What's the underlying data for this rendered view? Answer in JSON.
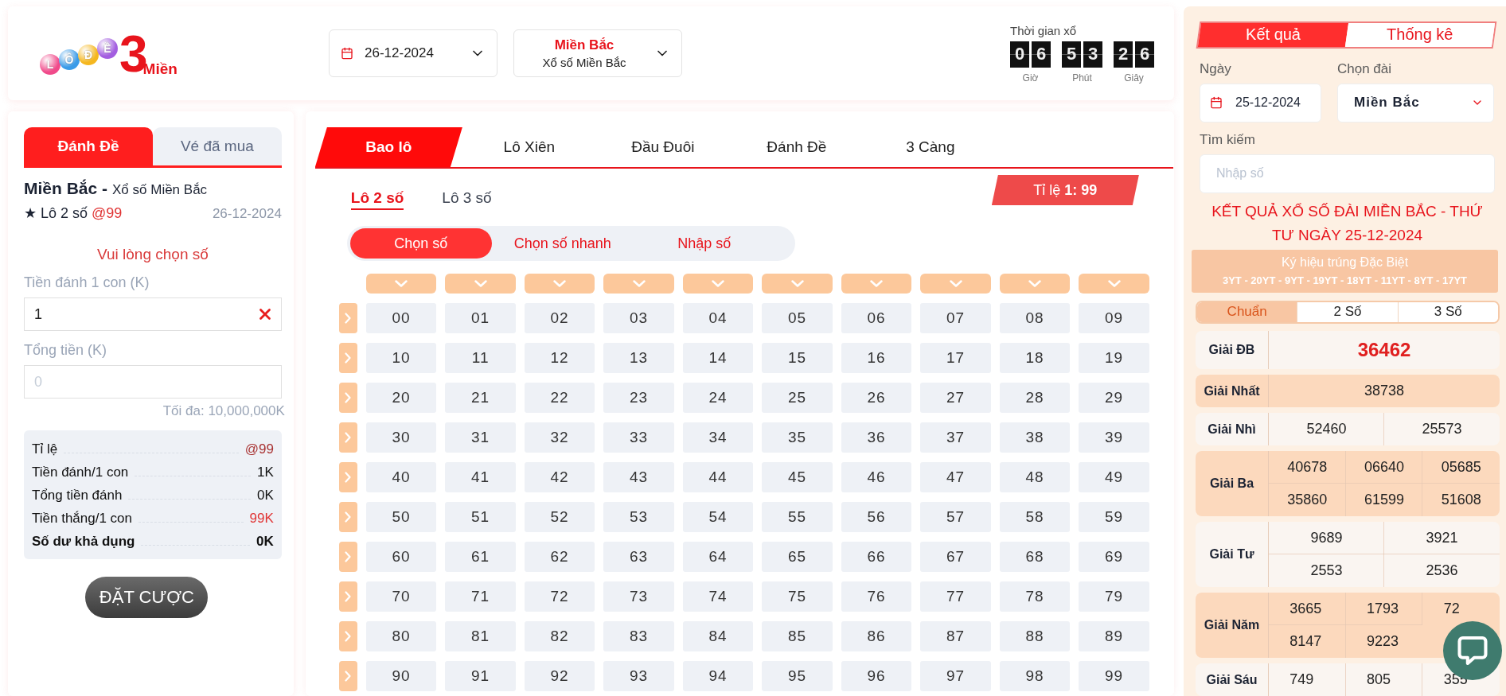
{
  "header": {
    "logo": {
      "letters": [
        "L",
        "Ô",
        "Đ",
        "Ề"
      ],
      "number": "3",
      "word": "Miền"
    },
    "date_select": {
      "value": "26-12-2024"
    },
    "region_select": {
      "title": "Miền Bắc",
      "subtitle": "Xổ số Miền Bắc"
    },
    "countdown": {
      "label": "Thời gian xổ",
      "units": [
        {
          "digits": [
            "0",
            "6"
          ],
          "label": "Giờ"
        },
        {
          "digits": [
            "5",
            "3"
          ],
          "label": "Phút"
        },
        {
          "digits": [
            "2",
            "6"
          ],
          "label": "Giây"
        }
      ]
    }
  },
  "bet_panel": {
    "tabs": [
      {
        "label": "Đánh Đề",
        "selected": true
      },
      {
        "label": "Vé đã mua",
        "selected": false
      }
    ],
    "region": "Miền Bắc -",
    "region_sub": "Xổ số Miền Bắc",
    "bet_type": "★ Lô 2 số",
    "odds": "@99",
    "date": "26-12-2024",
    "notice": "Vui lòng chọn số",
    "amount": {
      "label": "Tiền đánh 1 con (K)",
      "value": "1"
    },
    "total": {
      "label": "Tổng tiền (K)",
      "placeholder": "0"
    },
    "max_note": "Tối đa: 10,000,000K",
    "summary": [
      {
        "label": "Tỉ lệ",
        "value": "@99",
        "kind": "odds"
      },
      {
        "label": "Tiền đánh/1 con",
        "value": "1K",
        "kind": "plain"
      },
      {
        "label": "Tổng tiền đánh",
        "value": "0K",
        "kind": "plain"
      },
      {
        "label": "Tiền thắng/1 con",
        "value": "99K",
        "kind": "win"
      },
      {
        "label": "Số dư khả dụng",
        "value": "0K",
        "kind": "strong"
      }
    ],
    "submit": "ĐẶT CƯỢC"
  },
  "game": {
    "tabs": [
      {
        "label": "Bao lô",
        "selected": true
      },
      {
        "label": "Lô Xiên",
        "selected": false
      },
      {
        "label": "Đầu Đuôi",
        "selected": false
      },
      {
        "label": "Đánh Đề",
        "selected": false
      },
      {
        "label": "3 Càng",
        "selected": false
      }
    ],
    "subtabs": [
      {
        "label": "Lô 2 số",
        "selected": true
      },
      {
        "label": "Lô 3 số",
        "selected": false
      }
    ],
    "ratio": {
      "label": "Tỉ lệ",
      "value": "1: 99"
    },
    "modes": [
      {
        "label": "Chọn số",
        "selected": true
      },
      {
        "label": "Chọn số nhanh",
        "selected": false
      },
      {
        "label": "Nhập số",
        "selected": false
      }
    ],
    "grid": [
      [
        "00",
        "01",
        "02",
        "03",
        "04",
        "05",
        "06",
        "07",
        "08",
        "09"
      ],
      [
        "10",
        "11",
        "12",
        "13",
        "14",
        "15",
        "16",
        "17",
        "18",
        "19"
      ],
      [
        "20",
        "21",
        "22",
        "23",
        "24",
        "25",
        "26",
        "27",
        "28",
        "29"
      ],
      [
        "30",
        "31",
        "32",
        "33",
        "34",
        "35",
        "36",
        "37",
        "38",
        "39"
      ],
      [
        "40",
        "41",
        "42",
        "43",
        "44",
        "45",
        "46",
        "47",
        "48",
        "49"
      ],
      [
        "50",
        "51",
        "52",
        "53",
        "54",
        "55",
        "56",
        "57",
        "58",
        "59"
      ],
      [
        "60",
        "61",
        "62",
        "63",
        "64",
        "65",
        "66",
        "67",
        "68",
        "69"
      ],
      [
        "70",
        "71",
        "72",
        "73",
        "74",
        "75",
        "76",
        "77",
        "78",
        "79"
      ],
      [
        "80",
        "81",
        "82",
        "83",
        "84",
        "85",
        "86",
        "87",
        "88",
        "89"
      ],
      [
        "90",
        "91",
        "92",
        "93",
        "94",
        "95",
        "96",
        "97",
        "98",
        "99"
      ]
    ]
  },
  "results": {
    "tabs": [
      {
        "label": "Kết quả",
        "selected": true
      },
      {
        "label": "Thống kê",
        "selected": false
      }
    ],
    "date": {
      "label": "Ngày",
      "value": "25-12-2024"
    },
    "station": {
      "label": "Chọn đài",
      "value": "Miền Bắc"
    },
    "search": {
      "label": "Tìm kiếm",
      "placeholder": "Nhập số"
    },
    "title": "KẾT QUẢ XỔ SỐ ĐÀI MIỀN BẮC - THỨ TƯ NGÀY 25-12-2024",
    "special_codes": {
      "label": "Ký hiệu trúng Đặc Biệt",
      "codes": "3YT - 20YT - 9YT - 19YT - 18YT - 11YT - 8YT - 17YT"
    },
    "digit_tabs": [
      {
        "label": "Chuẩn",
        "selected": true
      },
      {
        "label": "2 Số",
        "selected": false
      },
      {
        "label": "3 Số",
        "selected": false
      }
    ],
    "prizes": [
      {
        "name": "Giải ĐB",
        "kind": "special",
        "numbers": [
          "36462"
        ]
      },
      {
        "name": "Giải Nhất",
        "kind": "single",
        "numbers": [
          "38738"
        ]
      },
      {
        "name": "Giải Nhì",
        "kind": "pair",
        "numbers": [
          "52460",
          "25573"
        ]
      },
      {
        "name": "Giải Ba",
        "kind": "triple",
        "numbers": [
          "40678",
          "06640",
          "05685",
          "35860",
          "61599",
          "51608"
        ]
      },
      {
        "name": "Giải Tư",
        "kind": "pair",
        "numbers": [
          "9689",
          "3921",
          "2553",
          "2536"
        ]
      },
      {
        "name": "Giải Năm",
        "kind": "triple",
        "numbers": [
          "3665",
          "1793",
          "72",
          "8147",
          "9223"
        ]
      },
      {
        "name": "Giải Sáu",
        "kind": "triple",
        "numbers": [
          "749",
          "805",
          "355"
        ]
      }
    ]
  }
}
